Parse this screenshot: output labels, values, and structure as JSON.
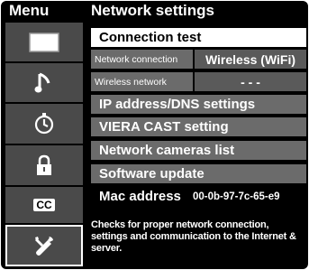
{
  "sidebar": {
    "title": "Menu",
    "items": [
      {
        "icon": "picture-icon"
      },
      {
        "icon": "sound-icon"
      },
      {
        "icon": "timer-icon"
      },
      {
        "icon": "lock-icon"
      },
      {
        "icon": "closed-caption-icon",
        "label": "CC"
      },
      {
        "icon": "setup-icon"
      }
    ]
  },
  "panel": {
    "title": "Network settings",
    "connection_test": "Connection test",
    "network_connection": {
      "label": "Network connection",
      "value": "Wireless (WiFi)"
    },
    "wireless_network": {
      "label": "Wireless network",
      "value": "- - -"
    },
    "ip_dns": "IP address/DNS settings",
    "viera_cast": "VIERA CAST setting",
    "network_cameras": "Network cameras list",
    "software_update": "Software update",
    "mac": {
      "label": "Mac address",
      "value": "00-0b-97-7c-65-e9"
    },
    "help_text": "Checks for proper network connection, settings and communication to the Internet & server."
  },
  "colors": {
    "background": "#000000",
    "row": "#6b6b6b",
    "sidebar_item": "#4a4a4a",
    "selected": "#ffffff"
  }
}
